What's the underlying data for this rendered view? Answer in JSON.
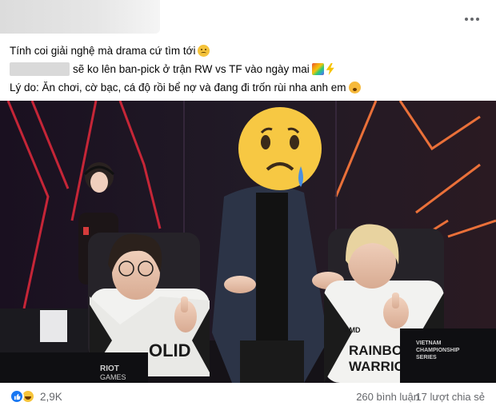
{
  "post": {
    "line1": "Tính coi giải nghệ mà drama cứ tìm tới",
    "line2": "sẽ ko lên ban-pick ở trận RW vs TF vào ngày mai",
    "line3": "Lý do: Ăn chơi, cờ bạc, cá độ rồi bể nợ và đang đi trốn rùi nha anh em"
  },
  "photo": {
    "jersey_left_text": "OLID",
    "jersey_right_line1": "RAINBO",
    "jersey_right_line2": "WARRIOR",
    "sponsor": "AMD",
    "monitor_left_line1": "RIOT",
    "monitor_left_line2": "GAMES",
    "monitor_right_line1": "VIETNAM",
    "monitor_right_line2": "CHAMPIONSHIP",
    "monitor_right_line3": "SERIES"
  },
  "footer": {
    "reaction_count": "2,9K",
    "comments": "260 bình luận",
    "shares": "17 lượt chia sẻ"
  },
  "colors": {
    "accent": "#1877f2",
    "muted": "#65676b",
    "neon_red": "#d8283a",
    "neon_orange": "#ff7a3c"
  },
  "icons": [
    "more-options-icon",
    "sad-face-emoji",
    "rainbow-emoji",
    "lightning-emoji",
    "worried-face-emoji",
    "like-reaction-icon",
    "haha-reaction-icon",
    "sad-tear-emoji-sticker"
  ]
}
